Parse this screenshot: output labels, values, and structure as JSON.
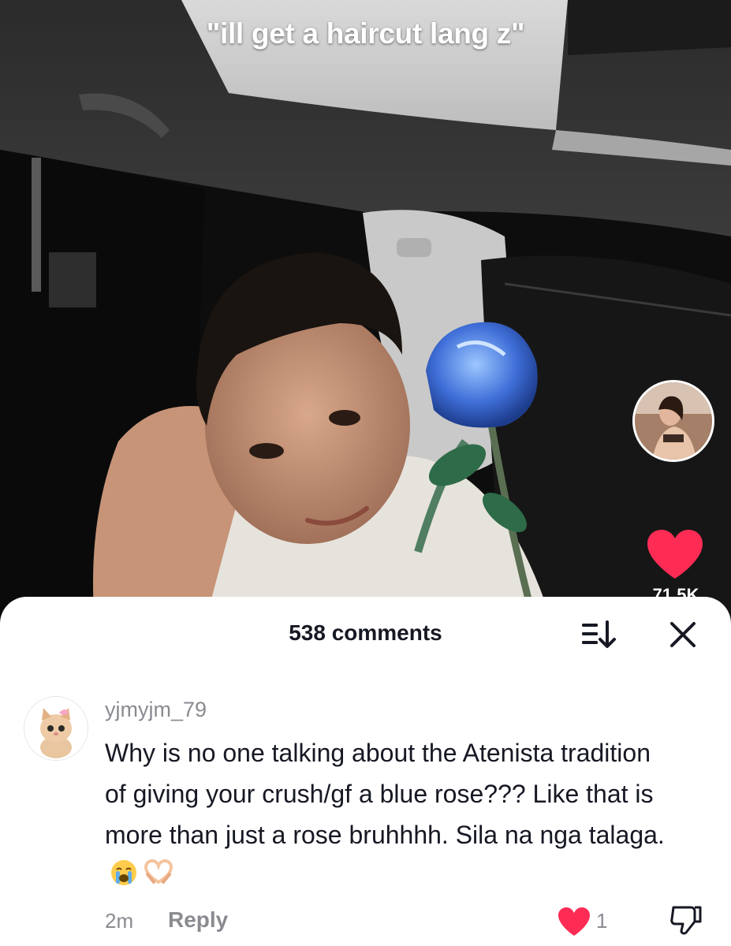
{
  "video": {
    "caption": "\"ill get a haircut lang z\"",
    "like_count": "71.5K"
  },
  "comments_sheet": {
    "title": "538 comments",
    "sort_icon": "sort-icon",
    "close_icon": "close-icon"
  },
  "comment": {
    "username": "yjmyjm_79",
    "text": "Why is no one talking about the Atenista tradition of giving your crush/gf a blue rose??? Like that is more than just a rose bruhhhh. Sila na nga talaga.",
    "emojis": [
      "loudly-crying-face",
      "heart-hands"
    ],
    "time": "2m",
    "reply_label": "Reply",
    "like_count": "1"
  },
  "colors": {
    "like_red": "#FE2C55",
    "text_primary": "#161823",
    "text_secondary": "#8A8B91"
  }
}
